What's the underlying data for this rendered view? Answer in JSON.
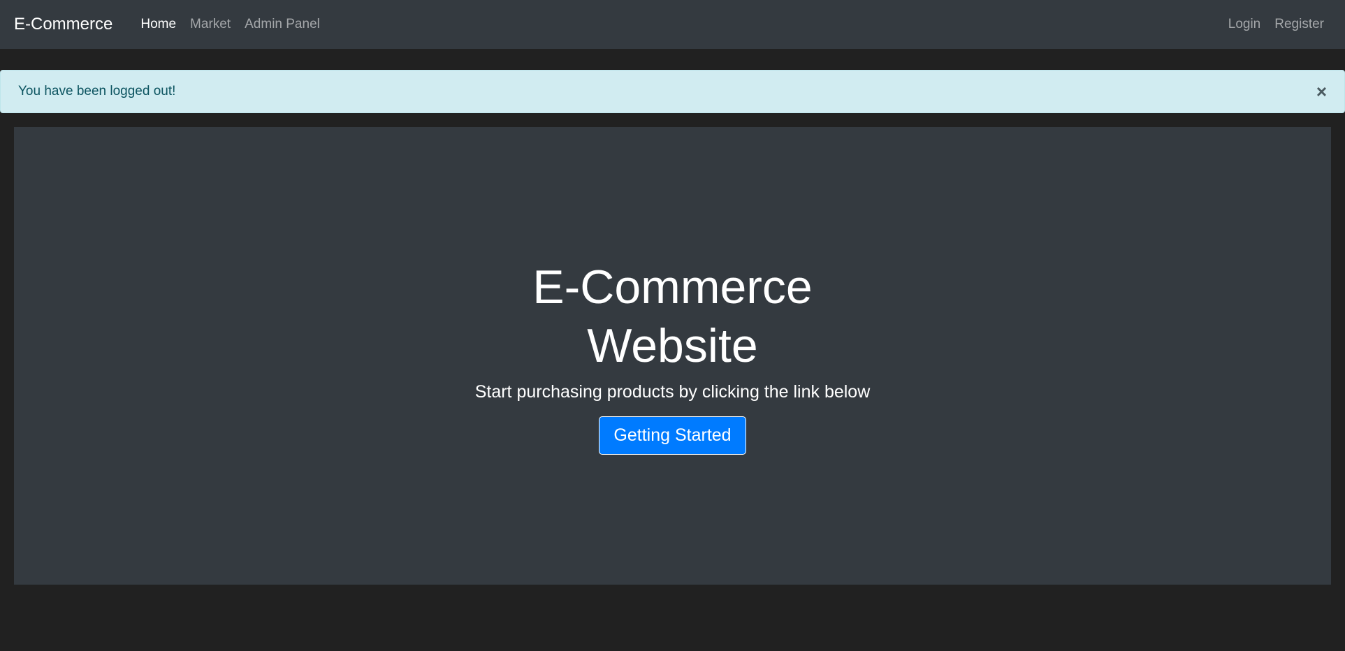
{
  "navbar": {
    "brand": "E-Commerce",
    "left_links": [
      {
        "label": "Home",
        "active": true
      },
      {
        "label": "Market",
        "active": false
      },
      {
        "label": "Admin Panel",
        "active": false
      }
    ],
    "right_links": [
      {
        "label": "Login"
      },
      {
        "label": "Register"
      }
    ]
  },
  "alert": {
    "message": "You have been logged out!",
    "close_symbol": "×"
  },
  "hero": {
    "title": "E-Commerce Website",
    "subtitle": "Start purchasing products by clicking the link below",
    "cta_label": "Getting Started"
  },
  "colors": {
    "page_bg": "#212121",
    "navbar_bg": "#343a40",
    "alert_bg": "#d1ecf1",
    "alert_text": "#0c5460",
    "primary": "#007bff"
  }
}
